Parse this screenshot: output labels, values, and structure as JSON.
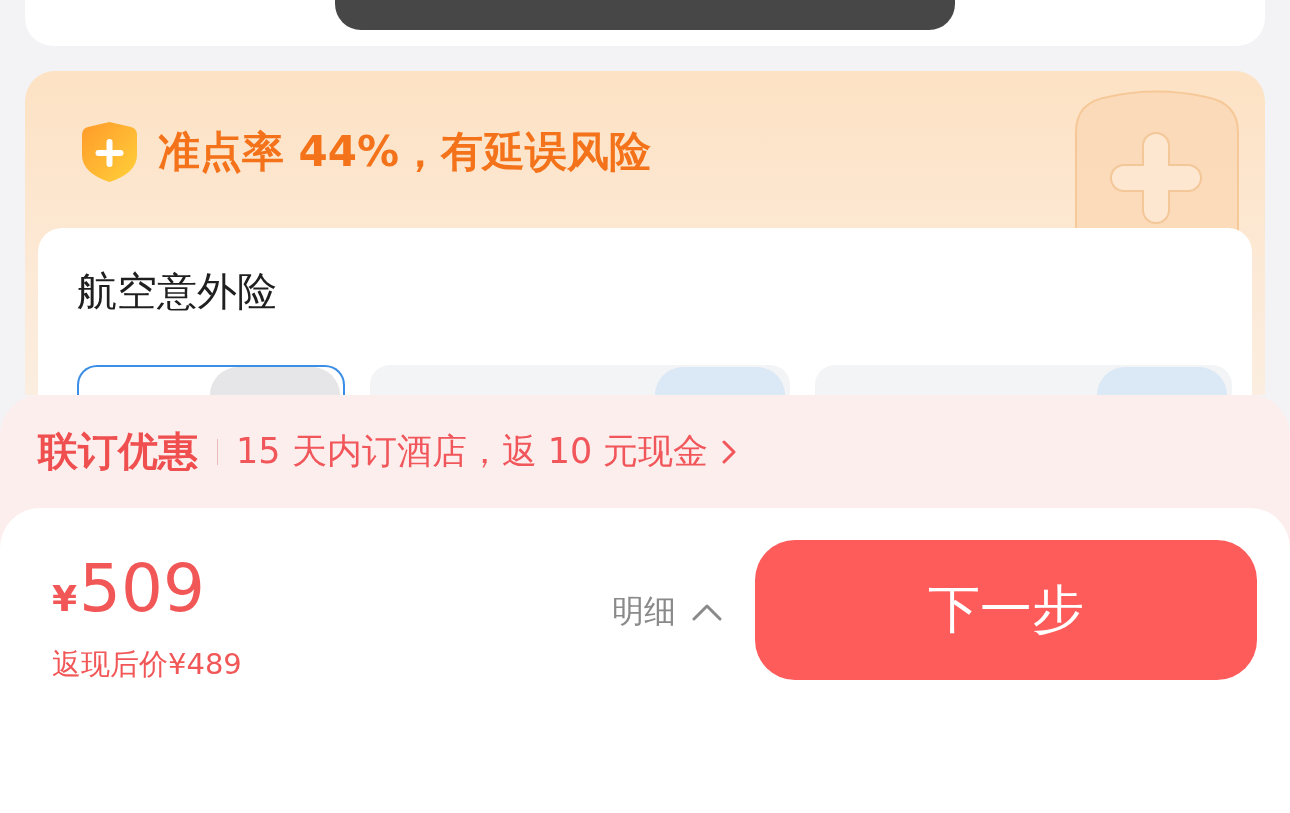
{
  "ontime_banner": {
    "title": "准点率 44%，有延误风险"
  },
  "insurance": {
    "title": "航空意外险",
    "options": [
      {
        "selected": true
      },
      {
        "selected": false
      },
      {
        "selected": false
      }
    ]
  },
  "promo": {
    "tag": "联订优惠",
    "text": "15 天内订酒店，返 10 元现金"
  },
  "checkout": {
    "currency": "¥",
    "amount": "509",
    "after_cashback": "返现后价¥489",
    "details_label": "明细",
    "details_expanded": false,
    "next_button": "下一步"
  }
}
